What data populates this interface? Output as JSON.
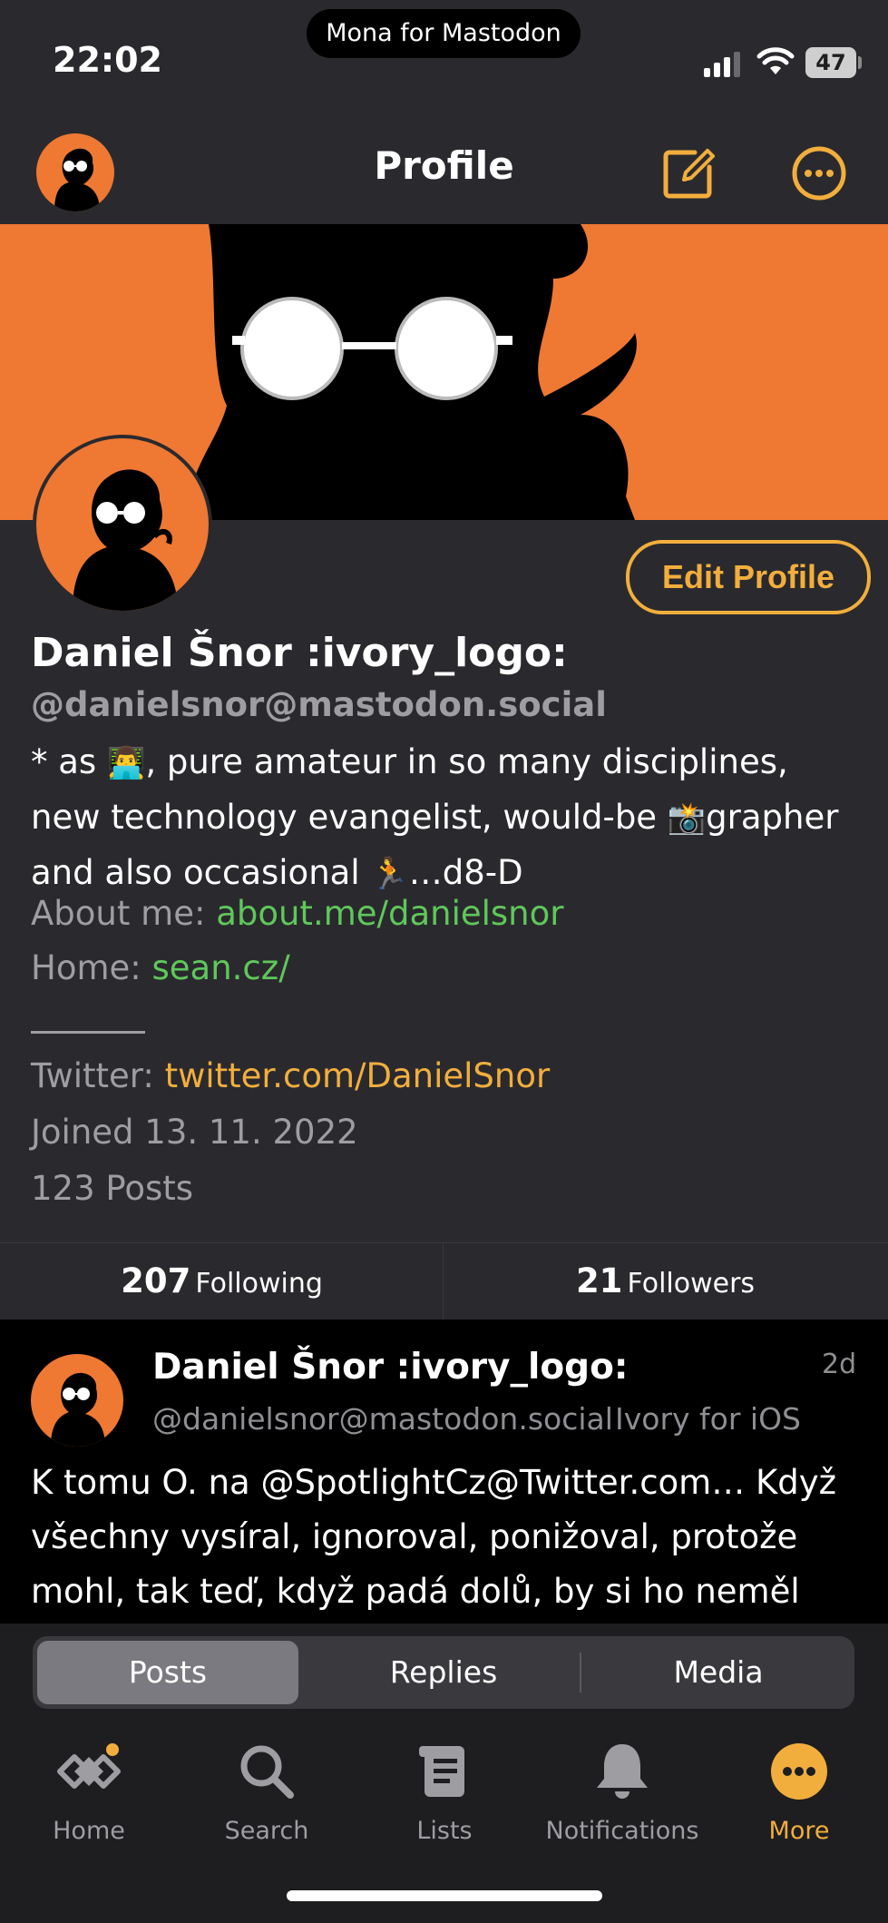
{
  "status_bar": {
    "time": "22:02",
    "island_text": "Mona for Mastodon",
    "battery": "47"
  },
  "header": {
    "title": "Profile",
    "compose_icon": "compose-icon",
    "more_icon": "ellipsis-circle-icon"
  },
  "profile": {
    "edit_label": "Edit Profile",
    "display_name": "Daniel Šnor :ivory_logo:",
    "handle": "@danielsnor@mastodon.social",
    "bio_line1_a": "* as ",
    "bio_emoji1": "👨‍💻",
    "bio_line1_b": ", pure amateur in so many disciplines,",
    "bio_line2_a": "new technology evangelist, would-be ",
    "bio_emoji2": "📸",
    "bio_line2_b": "grapher",
    "bio_line3_a": "and also occasional ",
    "bio_emoji3": "🏃",
    "bio_line3_b": "…d8-D",
    "about_label": "About me: ",
    "about_link": "about.me/danielsnor",
    "home_label": "Home: ",
    "home_link": "sean.cz/",
    "twitter_label": "Twitter: ",
    "twitter_link": "twitter.com/DanielSnor",
    "joined": "Joined 13. 11. 2022",
    "posts_count": "123 Posts"
  },
  "follow": {
    "following_count": "207",
    "following_label": "Following",
    "followers_count": "21",
    "followers_label": "Followers"
  },
  "post": {
    "name": "Daniel Šnor :ivory_logo:",
    "time": "2d",
    "handle": "@danielsnor@mastodon.social",
    "client": "Ivory for iOS",
    "text_line1": "K tomu O. na @SpotlightCz@Twitter.com… Když",
    "text_line2": "všechny vysíral, ignoroval, ponižoval, protože",
    "text_line3": "mohl, tak teď, když padá dolů, by si ho neměl"
  },
  "segments": {
    "posts": "Posts",
    "replies": "Replies",
    "media": "Media",
    "active": "Posts"
  },
  "tabs": [
    {
      "label": "Home",
      "icon": "home-icon"
    },
    {
      "label": "Search",
      "icon": "search-icon"
    },
    {
      "label": "Lists",
      "icon": "lists-icon"
    },
    {
      "label": "Notifications",
      "icon": "bell-icon"
    },
    {
      "label": "More",
      "icon": "more-icon"
    }
  ],
  "colors": {
    "accent": "#f2ae3d",
    "banner": "#ef7833",
    "link_green": "#5fc85a",
    "background": "#2a2a2e"
  }
}
